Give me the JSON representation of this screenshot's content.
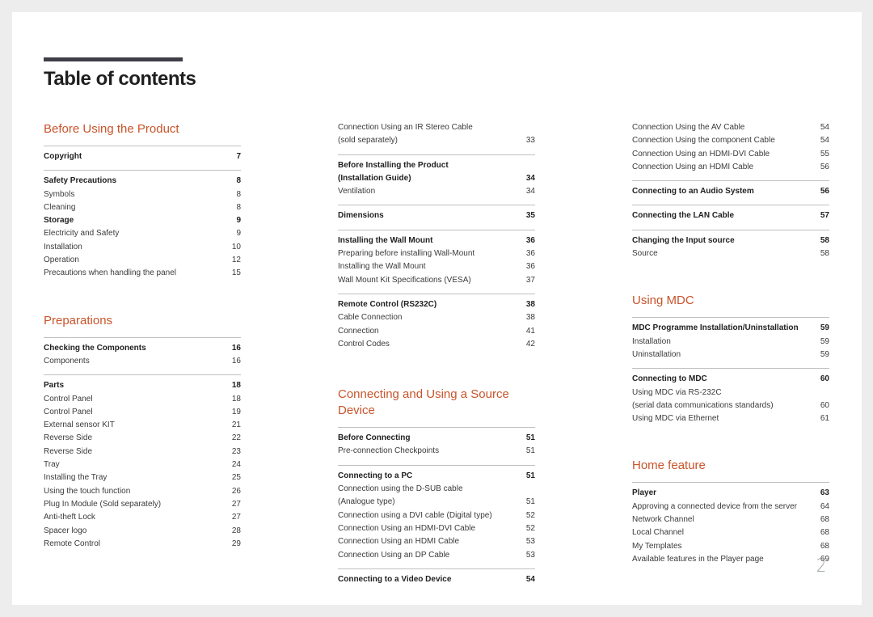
{
  "title": "Table of contents",
  "page_number": "2",
  "colors": {
    "section_title": "#c8542b",
    "title_bar": "#403f47",
    "background": "#ededed"
  },
  "columns": [
    [
      {
        "section": "Before Using the Product",
        "groups": [
          {
            "rows": [
              {
                "label": "Copyright",
                "page": "7",
                "bold": true
              }
            ]
          },
          {
            "rows": [
              {
                "label": "Safety Precautions",
                "page": "8",
                "bold": true
              },
              {
                "label": "Symbols",
                "page": "8"
              },
              {
                "label": "Cleaning",
                "page": "8"
              },
              {
                "label": "Storage",
                "page": "9",
                "bold": true
              },
              {
                "label": "Electricity and Safety",
                "page": "9"
              },
              {
                "label": "Installation",
                "page": "10"
              },
              {
                "label": "Operation",
                "page": "12"
              },
              {
                "label": "Precautions when handling the panel",
                "page": "15"
              }
            ]
          }
        ]
      },
      {
        "section": "Preparations",
        "groups": [
          {
            "rows": [
              {
                "label": "Checking the Components",
                "page": "16",
                "bold": true
              },
              {
                "label": "Components",
                "page": "16"
              }
            ]
          },
          {
            "rows": [
              {
                "label": "Parts",
                "page": "18",
                "bold": true
              },
              {
                "label": "Control Panel",
                "page": "18"
              },
              {
                "label": "Control Panel",
                "page": "19"
              },
              {
                "label": "External sensor KIT",
                "page": "21"
              },
              {
                "label": "Reverse Side",
                "page": "22"
              },
              {
                "label": "Reverse Side",
                "page": "23"
              },
              {
                "label": "Tray",
                "page": "24"
              },
              {
                "label": "Installing the Tray",
                "page": "25"
              },
              {
                "label": "Using the touch function",
                "page": "26"
              },
              {
                "label": "Plug In Module (Sold separately)",
                "page": "27"
              },
              {
                "label": "Anti-theft Lock",
                "page": "27"
              },
              {
                "label": "Spacer logo",
                "page": "28"
              },
              {
                "label": "Remote Control",
                "page": "29"
              }
            ]
          }
        ]
      }
    ],
    [
      {
        "section": "",
        "groups": [
          {
            "noborder": true,
            "rows": [
              {
                "label": "Connection Using an IR Stereo Cable",
                "page": ""
              },
              {
                "label": "(sold separately)",
                "page": "33"
              }
            ]
          },
          {
            "rows": [
              {
                "label": "Before Installing the Product",
                "page": "",
                "bold": true
              },
              {
                "label": "(Installation Guide)",
                "page": "34",
                "bold": true
              },
              {
                "label": "Ventilation",
                "page": "34"
              }
            ]
          },
          {
            "rows": [
              {
                "label": "Dimensions",
                "page": "35",
                "bold": true
              }
            ]
          },
          {
            "rows": [
              {
                "label": "Installing the Wall Mount",
                "page": "36",
                "bold": true
              },
              {
                "label": "Preparing before installing Wall-Mount",
                "page": "36"
              },
              {
                "label": "Installing the Wall Mount",
                "page": "36"
              },
              {
                "label": "Wall Mount Kit Specifications (VESA)",
                "page": "37"
              }
            ]
          },
          {
            "rows": [
              {
                "label": "Remote Control (RS232C)",
                "page": "38",
                "bold": true
              },
              {
                "label": "Cable Connection",
                "page": "38"
              },
              {
                "label": "Connection",
                "page": "41"
              },
              {
                "label": "Control Codes",
                "page": "42"
              }
            ]
          }
        ]
      },
      {
        "section": "Connecting and Using a Source Device",
        "groups": [
          {
            "rows": [
              {
                "label": "Before Connecting",
                "page": "51",
                "bold": true
              },
              {
                "label": "Pre-connection Checkpoints",
                "page": "51"
              }
            ]
          },
          {
            "rows": [
              {
                "label": "Connecting to a PC",
                "page": "51",
                "bold": true
              },
              {
                "label": "Connection using the D-SUB cable",
                "page": ""
              },
              {
                "label": "(Analogue type)",
                "page": "51"
              },
              {
                "label": "Connection using a DVI cable (Digital type)",
                "page": "52"
              },
              {
                "label": "Connection Using an HDMI-DVI Cable",
                "page": "52"
              },
              {
                "label": "Connection Using an HDMI Cable",
                "page": "53"
              },
              {
                "label": "Connection Using an DP Cable",
                "page": "53"
              }
            ]
          },
          {
            "rows": [
              {
                "label": "Connecting to a Video Device",
                "page": "54",
                "bold": true
              }
            ]
          }
        ]
      }
    ],
    [
      {
        "section": "",
        "groups": [
          {
            "noborder": true,
            "rows": [
              {
                "label": "Connection Using the AV Cable",
                "page": "54"
              },
              {
                "label": "Connection Using the component Cable",
                "page": "54"
              },
              {
                "label": "Connection Using an HDMI-DVI Cable",
                "page": "55"
              },
              {
                "label": "Connection Using an HDMI Cable",
                "page": "56"
              }
            ]
          },
          {
            "rows": [
              {
                "label": "Connecting to an Audio System",
                "page": "56",
                "bold": true
              }
            ]
          },
          {
            "rows": [
              {
                "label": "Connecting the LAN Cable",
                "page": "57",
                "bold": true
              }
            ]
          },
          {
            "rows": [
              {
                "label": "Changing the Input source",
                "page": "58",
                "bold": true
              },
              {
                "label": "Source",
                "page": "58"
              }
            ]
          }
        ]
      },
      {
        "section": "Using MDC",
        "groups": [
          {
            "rows": [
              {
                "label": "MDC Programme Installation/Uninstallation",
                "page": "59",
                "bold": true
              },
              {
                "label": "Installation",
                "page": "59"
              },
              {
                "label": "Uninstallation",
                "page": "59"
              }
            ]
          },
          {
            "rows": [
              {
                "label": "Connecting to MDC",
                "page": "60",
                "bold": true
              },
              {
                "label": "Using MDC via RS-232C",
                "page": ""
              },
              {
                "label": "(serial data communications standards)",
                "page": "60"
              },
              {
                "label": "Using MDC via Ethernet",
                "page": "61"
              }
            ]
          }
        ]
      },
      {
        "section": "Home feature",
        "groups": [
          {
            "rows": [
              {
                "label": "Player",
                "page": "63",
                "bold": true
              },
              {
                "label": "Approving a connected device from the server",
                "page": "64"
              },
              {
                "label": "Network Channel",
                "page": "68"
              },
              {
                "label": "Local Channel",
                "page": "68"
              },
              {
                "label": "My Templates",
                "page": "68"
              },
              {
                "label": "Available features in the Player page",
                "page": "69"
              }
            ]
          }
        ]
      }
    ]
  ]
}
